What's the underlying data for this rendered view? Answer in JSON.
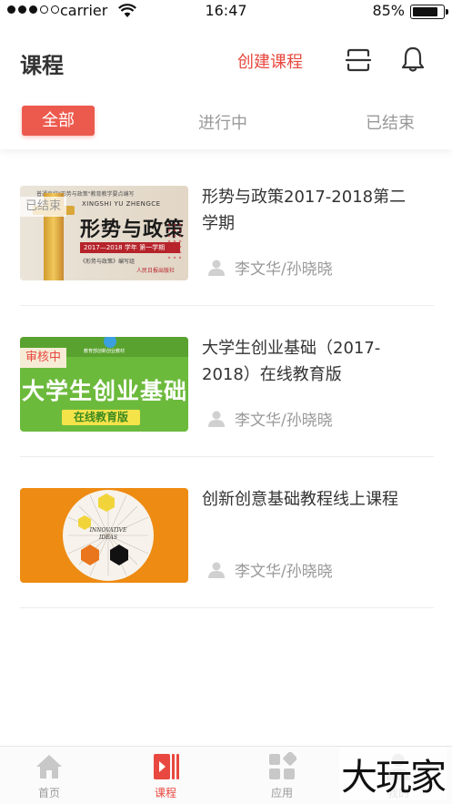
{
  "status_bar": {
    "carrier": "carrier",
    "time": "16:47",
    "battery": "85%",
    "battery_level": 0.85
  },
  "header": {
    "title": "课程",
    "create_label": "创建课程",
    "icons": [
      "scan-icon",
      "bell-icon"
    ]
  },
  "tabs": [
    {
      "label": "全部",
      "active": true
    },
    {
      "label": "进行中",
      "active": false
    },
    {
      "label": "已结束",
      "active": false
    }
  ],
  "courses": [
    {
      "title": "形势与政策2017-2018第二学期",
      "teacher": "李文华/孙晓晓",
      "badge": "已结束",
      "cover": {
        "top_line": "普通高校\"形势与政策\"教育教学要点编写",
        "pinyin": "XINGSHI YU ZHENGCE",
        "big": "形势与政策",
        "band": "2017—2018 学年 第一学期",
        "small": "《形势与政策》编写组",
        "publisher": "人民日报出版社"
      }
    },
    {
      "title": "大学生创业基础（2017-2018）在线教育版",
      "teacher": "李文华/孙晓晓",
      "badge": "审核中",
      "cover": {
        "tiny": "教育部创新创业教材",
        "big": "大学生创业基础",
        "pill": "在线教育版"
      }
    },
    {
      "title": "创新创意基础教程线上课程",
      "teacher": "李文华/孙晓晓",
      "badge": "",
      "cover": {
        "text_line1": "INNOVATIVE",
        "text_line2": "IDEAS"
      }
    }
  ],
  "tabbar": [
    {
      "label": "首页",
      "icon": "home-icon",
      "active": false
    },
    {
      "label": "课程",
      "icon": "course-icon",
      "active": true
    },
    {
      "label": "应用",
      "icon": "apps-icon",
      "active": false
    },
    {
      "label": "我的",
      "icon": "me-icon",
      "active": false
    }
  ],
  "watermark": "大玩家",
  "colors": {
    "accent": "#e8483f",
    "tab_active_bg": "#ec5a4e",
    "muted": "#999999"
  }
}
